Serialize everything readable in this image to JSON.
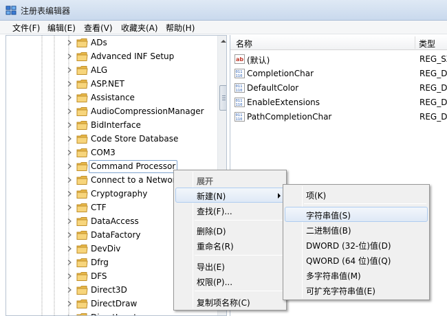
{
  "window": {
    "title": "注册表编辑器"
  },
  "menubar": [
    {
      "label": "文件(F)"
    },
    {
      "label": "编辑(E)"
    },
    {
      "label": "查看(V)"
    },
    {
      "label": "收藏夹(A)"
    },
    {
      "label": "帮助(H)"
    }
  ],
  "tree": {
    "items": [
      {
        "label": "ADs"
      },
      {
        "label": "Advanced INF Setup"
      },
      {
        "label": "ALG"
      },
      {
        "label": "ASP.NET"
      },
      {
        "label": "Assistance"
      },
      {
        "label": "AudioCompressionManager"
      },
      {
        "label": "BidInterface"
      },
      {
        "label": "Code Store Database"
      },
      {
        "label": "COM3"
      },
      {
        "label": "Command Processor"
      },
      {
        "label": "Connect to a Network"
      },
      {
        "label": "Cryptography"
      },
      {
        "label": "CTF"
      },
      {
        "label": "DataAccess"
      },
      {
        "label": "DataFactory"
      },
      {
        "label": "DevDiv"
      },
      {
        "label": "Dfrg"
      },
      {
        "label": "DFS"
      },
      {
        "label": "Direct3D"
      },
      {
        "label": "DirectDraw"
      },
      {
        "label": "DirectInput"
      }
    ],
    "selected": "Command Processor"
  },
  "values": {
    "columns": {
      "name": "名称",
      "type": "类型"
    },
    "rows": [
      {
        "name": "(默认)",
        "type": "REG_SZ",
        "icon": "string-value-icon"
      },
      {
        "name": "CompletionChar",
        "type": "REG_DWORD",
        "icon": "binary-value-icon"
      },
      {
        "name": "DefaultColor",
        "type": "REG_DWORD",
        "icon": "binary-value-icon"
      },
      {
        "name": "EnableExtensions",
        "type": "REG_DWORD",
        "icon": "binary-value-icon"
      },
      {
        "name": "PathCompletionChar",
        "type": "REG_DWORD",
        "icon": "binary-value-icon"
      }
    ]
  },
  "context_menu": {
    "expand": "展开",
    "new": "新建(N)",
    "find": "查找(F)...",
    "delete": "删除(D)",
    "rename": "重命名(R)",
    "export": "导出(E)",
    "permissions": "权限(P)...",
    "copy_key_name": "复制项名称(C)"
  },
  "submenu": {
    "key": "项(K)",
    "string_value": "字符串值(S)",
    "binary_value": "二进制值(B)",
    "dword_value": "DWORD (32-位)值(D)",
    "qword_value": "QWORD (64 位)值(Q)",
    "multi_string_value": "多字符串值(M)",
    "expandable_string_value": "可扩充字符串值(E)"
  },
  "colors": {
    "highlight_border": "#aeccf0",
    "folder": "#f2c45a",
    "titlebar": "#dfe9f5"
  }
}
